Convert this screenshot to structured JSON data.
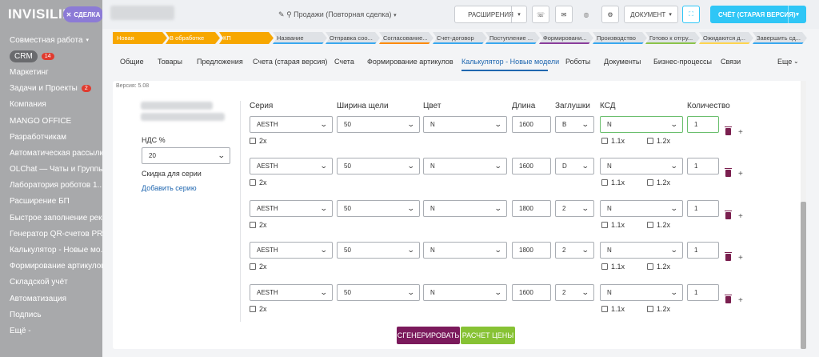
{
  "sidebar": {
    "brand": "INVISILINE",
    "deal_button": "СДЕЛКА",
    "items": [
      {
        "label": "Совместная работа",
        "caret": true
      },
      {
        "label": "CRM",
        "badge": "14",
        "pill": true
      },
      {
        "label": "Маркетинг"
      },
      {
        "label": "Задачи и Проекты",
        "badge": "2"
      },
      {
        "label": "Компания"
      },
      {
        "label": "MANGO OFFICE"
      },
      {
        "label": "Разработчикам"
      },
      {
        "label": "Автоматическая рассылк..."
      },
      {
        "label": "OLChat — Чаты и Группы..."
      },
      {
        "label": "Лаборатория роботов 1..."
      },
      {
        "label": "Расширение БП"
      },
      {
        "label": "Быстрое заполнение рек..."
      },
      {
        "label": "Генератор QR-счетов PR..."
      },
      {
        "label": "Калькулятор - Новые мо..."
      },
      {
        "label": "Формирование артикулов"
      },
      {
        "label": "Складской учёт"
      },
      {
        "label": "Автоматизация"
      },
      {
        "label": "Подпись"
      },
      {
        "label": "Ещё -"
      }
    ]
  },
  "header": {
    "deal_title": "Продажи (Повторная сделка)",
    "extensions": "РАСШИРЕНИЯ",
    "document": "ДОКУМЕНТ",
    "invoice_button": "СЧЁТ (СТАРАЯ ВЕРСИЯ)"
  },
  "stages": [
    {
      "label": "Новая",
      "color": "#f7a700"
    },
    {
      "label": "В обработке",
      "color": "#f7a700"
    },
    {
      "label": "КП",
      "color": "#f7a700"
    },
    {
      "label": "Название",
      "color": "#dfe2e6",
      "border": "#39a8ef"
    },
    {
      "label": "Отправка соо...",
      "color": "#dfe2e6",
      "border": "#39a8ef"
    },
    {
      "label": "Согласование...",
      "color": "#dfe2e6",
      "border": "#ff8a00"
    },
    {
      "label": "Счет-договор",
      "color": "#dfe2e6",
      "border": "#39a8ef"
    },
    {
      "label": "Поступление ...",
      "color": "#dfe2e6",
      "border": "#39a8ef"
    },
    {
      "label": "Формировани...",
      "color": "#dfe2e6",
      "border": "#8a3d9c"
    },
    {
      "label": "Производство",
      "color": "#dfe2e6",
      "border": "#39a8ef"
    },
    {
      "label": "Готово к отгру...",
      "color": "#dfe2e6",
      "border": "#8bc34a"
    },
    {
      "label": "Ожидаются д...",
      "color": "#dfe2e6",
      "border": "#ffd54f"
    },
    {
      "label": "Завершить сд...",
      "color": "#dfe2e6",
      "border": "#39a8ef"
    }
  ],
  "tabs": [
    {
      "label": "Общие"
    },
    {
      "label": "Товары"
    },
    {
      "label": "Предложения"
    },
    {
      "label": "Счета (старая версия)"
    },
    {
      "label": "Счета"
    },
    {
      "label": "Формирование артикулов"
    },
    {
      "label": "Калькулятор - Новые модели",
      "active": true
    },
    {
      "label": "Роботы"
    },
    {
      "label": "Документы"
    },
    {
      "label": "Бизнес-процессы"
    },
    {
      "label": "Связи"
    },
    {
      "label": "Еще"
    }
  ],
  "calculator": {
    "version": "Версия: 5.08",
    "nds_label": "НДС %",
    "nds_value": "20",
    "discount_label": "Скидка для серии",
    "add_series_link": "Добавить серию",
    "columns": [
      "Серия",
      "Ширина щели",
      "Цвет",
      "Длина",
      "Заглушки",
      "КСД",
      "Количество"
    ],
    "checkbox_2x": "2x",
    "checkbox_11x": "1.1x",
    "checkbox_12x": "1.2x",
    "rows": [
      {
        "series": "AESTH",
        "width": "50",
        "color": "N",
        "length": "1600",
        "caps": "B",
        "ksd": "N",
        "qty": "1"
      },
      {
        "series": "AESTH",
        "width": "50",
        "color": "N",
        "length": "1600",
        "caps": "D",
        "ksd": "N",
        "qty": "1"
      },
      {
        "series": "AESTH",
        "width": "50",
        "color": "N",
        "length": "1800",
        "caps": "2",
        "ksd": "N",
        "qty": "1"
      },
      {
        "series": "AESTH",
        "width": "50",
        "color": "N",
        "length": "1800",
        "caps": "2",
        "ksd": "N",
        "qty": "1"
      },
      {
        "series": "AESTH",
        "width": "50",
        "color": "N",
        "length": "1600",
        "caps": "2",
        "ksd": "N",
        "qty": "1"
      }
    ],
    "generate_button": "СГЕНЕРИРОВАТЬ",
    "price_button": "РАСЧЕТ ЦЕНЫ"
  }
}
